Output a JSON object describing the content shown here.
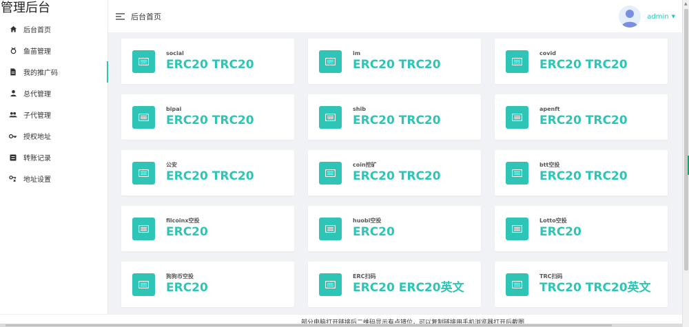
{
  "sidebar": {
    "brand": "管理后台",
    "items": [
      {
        "label": "后台首页",
        "icon": "home-icon"
      },
      {
        "label": "鱼苗管理",
        "icon": "fish-icon"
      },
      {
        "label": "我的推广码",
        "icon": "document-icon",
        "active": true
      },
      {
        "label": "总代管理",
        "icon": "user-icon"
      },
      {
        "label": "子代管理",
        "icon": "users-icon"
      },
      {
        "label": "授权地址",
        "icon": "key-icon"
      },
      {
        "label": "转账记录",
        "icon": "list-icon"
      },
      {
        "label": "地址设置",
        "icon": "settings-icon"
      }
    ]
  },
  "header": {
    "title": "后台首页",
    "user": "admin"
  },
  "cards": [
    {
      "name": "social",
      "types": "ERC20 TRC20"
    },
    {
      "name": "im",
      "types": "ERC20 TRC20"
    },
    {
      "name": "covid",
      "types": "ERC20 TRC20"
    },
    {
      "name": "bipai",
      "types": "ERC20 TRC20"
    },
    {
      "name": "shib",
      "types": "ERC20 TRC20"
    },
    {
      "name": "apenft",
      "types": "ERC20 TRC20"
    },
    {
      "name": "公安",
      "types": "ERC20 TRC20"
    },
    {
      "name": "coin挖矿",
      "types": "ERC20 TRC20"
    },
    {
      "name": "btt空投",
      "types": "ERC20 TRC20"
    },
    {
      "name": "filcoinx空投",
      "types": "ERC20"
    },
    {
      "name": "huobi空投",
      "types": "ERC20"
    },
    {
      "name": "Lotto空投",
      "types": "ERC20"
    },
    {
      "name": "狗狗币空投",
      "types": "ERC20"
    },
    {
      "name": "ERC扫码",
      "types": "ERC20 ERC20英文"
    },
    {
      "name": "TRC扫码",
      "types": "TRC20 TRC20英文"
    }
  ],
  "note": "部分电脑打开链接后二维码显示有点错位，可以复制链接用手机浏览器打开后截图",
  "colors": {
    "accent": "#2ec4b6"
  }
}
